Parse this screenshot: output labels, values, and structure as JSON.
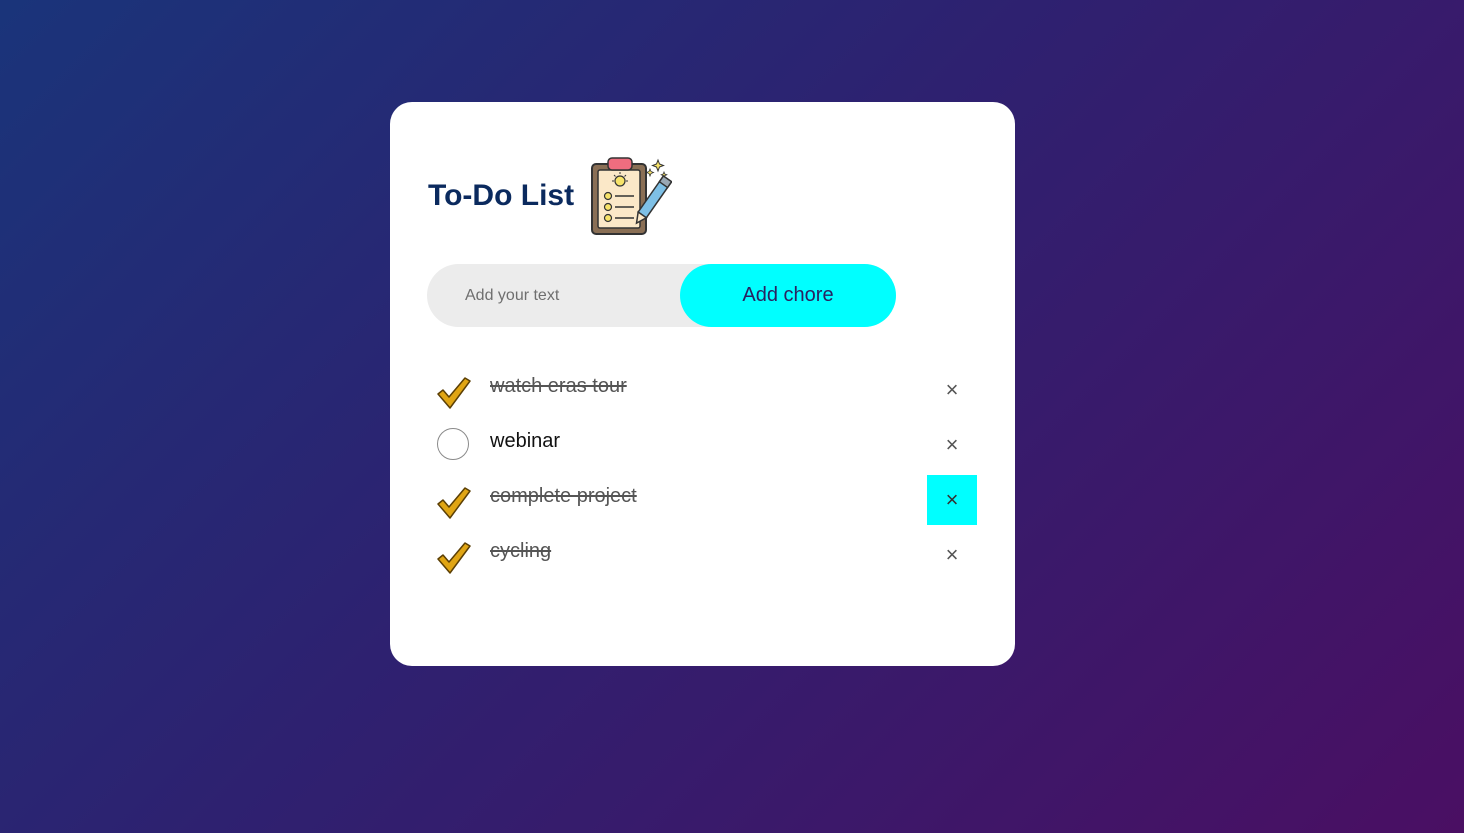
{
  "app": {
    "title": "To-Do List"
  },
  "input": {
    "placeholder": "Add your text",
    "value": ""
  },
  "add_button": {
    "label": "Add chore"
  },
  "tasks": [
    {
      "label": "watch eras tour",
      "done": true
    },
    {
      "label": "webinar",
      "done": false
    },
    {
      "label": "complete project",
      "done": true
    },
    {
      "label": "cycling",
      "done": true
    }
  ],
  "delete_icon": "×",
  "colors": {
    "accent": "#00ffff",
    "title": "#0b2a5e",
    "check": "#e0a514",
    "background_start": "#1a347a",
    "background_end": "#4a0f63"
  },
  "icons": {
    "logo": "clipboard-checklist-icon",
    "done": "checkmark-icon",
    "pending": "empty-circle-icon",
    "delete": "close-icon"
  }
}
